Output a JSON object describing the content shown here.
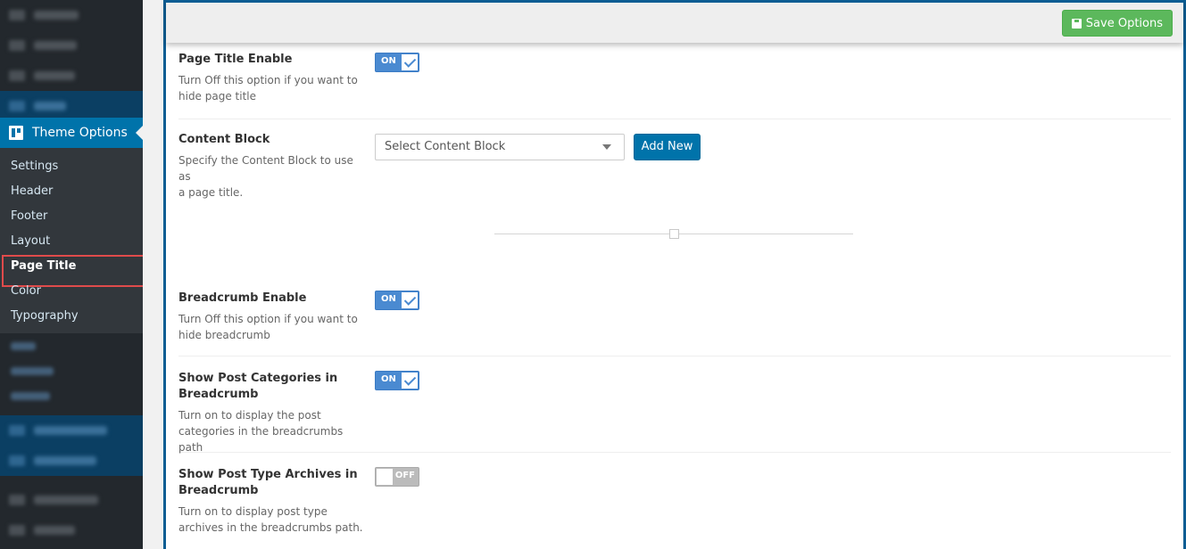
{
  "sidebar": {
    "theme_options_label": "Theme Options",
    "submenu": [
      {
        "label": "Settings",
        "active": false
      },
      {
        "label": "Header",
        "active": false
      },
      {
        "label": "Footer",
        "active": false
      },
      {
        "label": "Layout",
        "active": false
      },
      {
        "label": "Page Title",
        "active": true
      },
      {
        "label": "Color",
        "active": false
      },
      {
        "label": "Typography",
        "active": false
      }
    ],
    "active_color": "#0073aa",
    "highlight_color": "#e04b4b"
  },
  "toolbar": {
    "save_label": "Save Options",
    "save_color": "#5cb85c"
  },
  "options": {
    "page_title_enable": {
      "title": "Page Title Enable",
      "desc_line1": "Turn Off this option if you want to",
      "desc_line2": "hide page title",
      "state": "ON"
    },
    "content_block": {
      "title": "Content Block",
      "desc_line1": "Specify the Content Block to use as",
      "desc_line2": "a page title.",
      "placeholder": "Select Content Block",
      "add_new_label": "Add New"
    },
    "breadcrumb_enable": {
      "title": "Breadcrumb Enable",
      "desc_line1": "Turn Off this option if you want to",
      "desc_line2": "hide breadcrumb",
      "state": "ON"
    },
    "show_post_categories": {
      "title_line1": "Show Post Categories in",
      "title_line2": "Breadcrumb",
      "desc_line1": "Turn on to display the post",
      "desc_line2": "categories in the breadcrumbs path",
      "state": "ON"
    },
    "show_post_type_archives": {
      "title_line1": "Show Post Type Archives in",
      "title_line2": "Breadcrumb",
      "desc_line1": "Turn on to display post type",
      "desc_line2": "archives in the breadcrumbs path.",
      "state": "OFF"
    }
  }
}
